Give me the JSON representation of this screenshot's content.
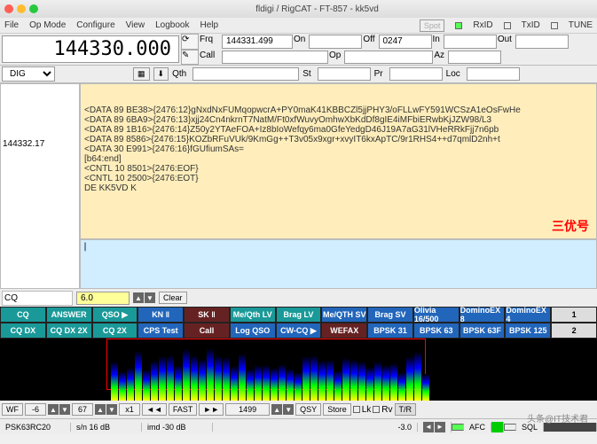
{
  "title": "fldigi / RigCAT - FT-857 - kk5vd",
  "menu": [
    "File",
    "Op Mode",
    "Configure",
    "View",
    "Logbook",
    "Help"
  ],
  "topright": {
    "spot": "Spot",
    "rxid": "RxID",
    "txid": "TxID",
    "tune": "TUNE"
  },
  "frequency": "144330.000",
  "fields": {
    "frq_lbl": "Frq",
    "frq": "144331.499",
    "on_lbl": "On",
    "on": "",
    "off_lbl": "Off",
    "off": "0247",
    "in_lbl": "In",
    "in": "",
    "out_lbl": "Out",
    "out": "",
    "call_lbl": "Call",
    "call": "",
    "op_lbl": "Op",
    "op": "",
    "az_lbl": "Az",
    "az": "",
    "qth_lbl": "Qth",
    "qth": "",
    "st_lbl": "St",
    "st": "",
    "pr_lbl": "Pr",
    "pr": "",
    "loc_lbl": "Loc",
    "loc": ""
  },
  "mode": "DIG",
  "sidefreq": "144332.17",
  "rx_lines": [
    "<DATA 89 BE38>{2476:12}gNxdNxFUMqopwcrA+PY0maK41KBBCZl5jjPHY3/oFLLwFY591WCSzA1eOsFwHe",
    "<DATA 89 6BA9>{2476:13}xjj24Cn4nkrnT7NatM/Ft0xfWuvyOmhwXbKdDf8gIE4iMFbiERwbKjJZW98/L3",
    "<DATA 89 1B16>{2476:14}Z50y2YTAeFOA+Iz8bIoWefqy6ma0GfeYedgD46J19A7aG31lVHeRRkFjj7n6pb",
    "<DATA 89 8586>{2476:15}KOZbRFuVUk/9KmGg++T3v05x9xgr+xvyIT6kxApTC/9r1RHS4++d7qmlD2nh+t",
    "<DATA 30 E991>{2476:16}fGUfiumSAs=",
    "[b64:end]",
    "<CNTL 10 8501>{2476:EOF}",
    "<CNTL 10 2500>{2476:EOT}",
    "",
    "DE KK5VD K"
  ],
  "watermark": "三优号",
  "cq_label": "CQ",
  "lvl": "6.0",
  "clear": "Clear",
  "macro1": [
    "CQ",
    "ANSWER",
    "QSO ▶",
    "KN ‖",
    "SK ‖",
    "Me/Qth LV",
    "Brag LV",
    "Me/QTH SV",
    "Brag SV",
    "Olivia 16/500",
    "DominoEX 8",
    "DominoEX 4"
  ],
  "macro2": [
    "CQ DX",
    "CQ DX 2X",
    "CQ 2X",
    "CPS Test",
    "Call",
    "Log QSO",
    "CW-CQ ▶",
    "WEFAX",
    "BPSK 31",
    "BPSK 63",
    "BPSK 63F",
    "BPSK 125"
  ],
  "row1": "1",
  "row2": "2",
  "wf": {
    "wf": "WF",
    "v1": "-6",
    "v2": "67",
    "x1": "x1",
    "fast": "FAST",
    "freq": "1499",
    "qsy": "QSY",
    "store": "Store",
    "lk": "Lk",
    "rv": "Rv",
    "tr": "T/R"
  },
  "status": {
    "mode": "PSK63RC20",
    "sn": "s/n 16 dB",
    "imd": "imd -30 dB",
    "afc": "AFC",
    "sql": "SQL",
    "pct": "-3.0"
  },
  "tri_l": "◄◄",
  "tri_r": "►►",
  "attrib": "头条@IT技术君"
}
